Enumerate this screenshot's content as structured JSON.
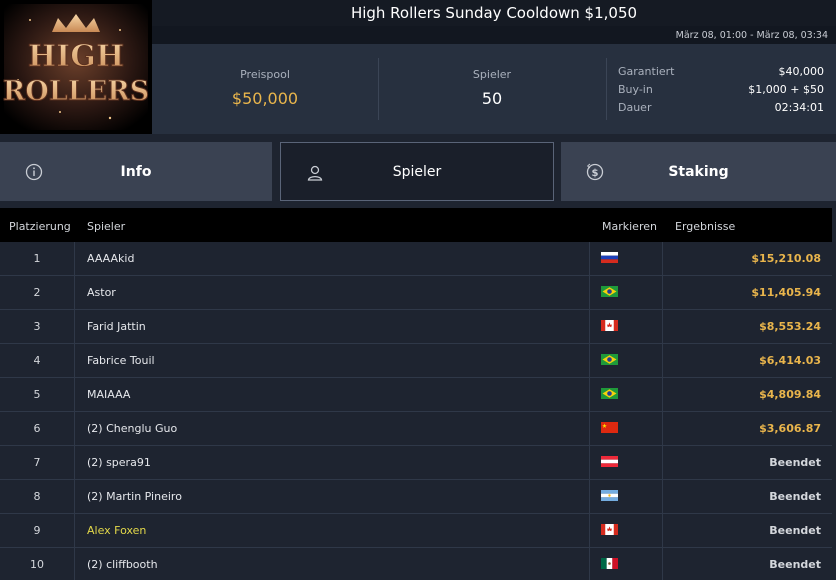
{
  "header": {
    "logo_text_top": "HIGH",
    "logo_text_bottom": "ROLLERS",
    "title": "High Rollers Sunday Cooldown $1,050",
    "date_range": "März 08, 01:00 - März 08, 03:34"
  },
  "stats": {
    "prizepool_label": "Preispool",
    "prizepool_value": "$50,000",
    "players_label": "Spieler",
    "players_value": "50",
    "details": [
      {
        "key": "Garantiert",
        "value": "$40,000"
      },
      {
        "key": "Buy-in",
        "value": "$1,000 + $50"
      },
      {
        "key": "Dauer",
        "value": "02:34:01"
      }
    ]
  },
  "tabs": {
    "info": "Info",
    "players": "Spieler",
    "staking": "Staking",
    "active": "players"
  },
  "table": {
    "headers": {
      "rank": "Platzierung",
      "player": "Spieler",
      "flag": "Markieren",
      "result": "Ergebnisse"
    },
    "rows": [
      {
        "rank": "1",
        "name": "AAAAkid",
        "flag": "ru",
        "result": "$15,210.08",
        "type": "money"
      },
      {
        "rank": "2",
        "name": "Astor",
        "flag": "br",
        "result": "$11,405.94",
        "type": "money"
      },
      {
        "rank": "3",
        "name": "Farid Jattin",
        "flag": "ca",
        "result": "$8,553.24",
        "type": "money"
      },
      {
        "rank": "4",
        "name": "Fabrice Touil",
        "flag": "br",
        "result": "$6,414.03",
        "type": "money"
      },
      {
        "rank": "5",
        "name": "MAIAAA",
        "flag": "br",
        "result": "$4,809.84",
        "type": "money"
      },
      {
        "rank": "6",
        "name": "(2) Chenglu Guo",
        "flag": "cn",
        "result": "$3,606.87",
        "type": "money"
      },
      {
        "rank": "7",
        "name": "(2) spera91",
        "flag": "at",
        "result": "Beendet",
        "type": "out"
      },
      {
        "rank": "8",
        "name": "(2) Martin Pineiro",
        "flag": "ar",
        "result": "Beendet",
        "type": "out"
      },
      {
        "rank": "9",
        "name": "Alex Foxen",
        "flag": "ca",
        "result": "Beendet",
        "type": "out",
        "highlight": true
      },
      {
        "rank": "10",
        "name": "(2) cliffbooth",
        "flag": "mx",
        "result": "Beendet",
        "type": "out"
      }
    ]
  },
  "colors": {
    "accent_gold": "#e9b54c",
    "highlight_name": "#e3d84a",
    "panel": "#27303f",
    "tab": "#3a4252"
  }
}
